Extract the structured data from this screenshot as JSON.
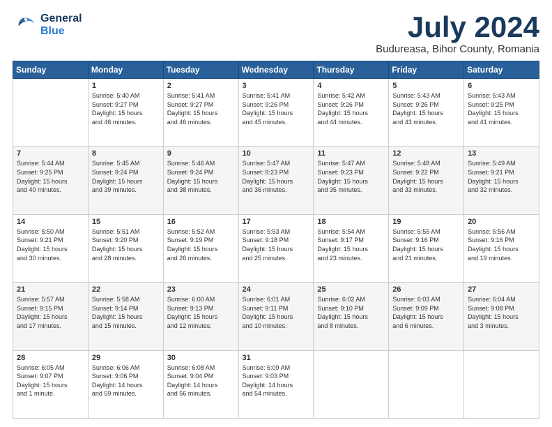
{
  "header": {
    "logo": {
      "general": "General",
      "blue": "Blue"
    },
    "title": "July 2024",
    "location": "Budureasa, Bihor County, Romania"
  },
  "weekdays": [
    "Sunday",
    "Monday",
    "Tuesday",
    "Wednesday",
    "Thursday",
    "Friday",
    "Saturday"
  ],
  "weeks": [
    [
      {
        "day": "",
        "info": ""
      },
      {
        "day": "1",
        "info": "Sunrise: 5:40 AM\nSunset: 9:27 PM\nDaylight: 15 hours\nand 46 minutes."
      },
      {
        "day": "2",
        "info": "Sunrise: 5:41 AM\nSunset: 9:27 PM\nDaylight: 15 hours\nand 46 minutes."
      },
      {
        "day": "3",
        "info": "Sunrise: 5:41 AM\nSunset: 9:26 PM\nDaylight: 15 hours\nand 45 minutes."
      },
      {
        "day": "4",
        "info": "Sunrise: 5:42 AM\nSunset: 9:26 PM\nDaylight: 15 hours\nand 44 minutes."
      },
      {
        "day": "5",
        "info": "Sunrise: 5:43 AM\nSunset: 9:26 PM\nDaylight: 15 hours\nand 43 minutes."
      },
      {
        "day": "6",
        "info": "Sunrise: 5:43 AM\nSunset: 9:25 PM\nDaylight: 15 hours\nand 41 minutes."
      }
    ],
    [
      {
        "day": "7",
        "info": "Sunrise: 5:44 AM\nSunset: 9:25 PM\nDaylight: 15 hours\nand 40 minutes."
      },
      {
        "day": "8",
        "info": "Sunrise: 5:45 AM\nSunset: 9:24 PM\nDaylight: 15 hours\nand 39 minutes."
      },
      {
        "day": "9",
        "info": "Sunrise: 5:46 AM\nSunset: 9:24 PM\nDaylight: 15 hours\nand 38 minutes."
      },
      {
        "day": "10",
        "info": "Sunrise: 5:47 AM\nSunset: 9:23 PM\nDaylight: 15 hours\nand 36 minutes."
      },
      {
        "day": "11",
        "info": "Sunrise: 5:47 AM\nSunset: 9:23 PM\nDaylight: 15 hours\nand 35 minutes."
      },
      {
        "day": "12",
        "info": "Sunrise: 5:48 AM\nSunset: 9:22 PM\nDaylight: 15 hours\nand 33 minutes."
      },
      {
        "day": "13",
        "info": "Sunrise: 5:49 AM\nSunset: 9:21 PM\nDaylight: 15 hours\nand 32 minutes."
      }
    ],
    [
      {
        "day": "14",
        "info": "Sunrise: 5:50 AM\nSunset: 9:21 PM\nDaylight: 15 hours\nand 30 minutes."
      },
      {
        "day": "15",
        "info": "Sunrise: 5:51 AM\nSunset: 9:20 PM\nDaylight: 15 hours\nand 28 minutes."
      },
      {
        "day": "16",
        "info": "Sunrise: 5:52 AM\nSunset: 9:19 PM\nDaylight: 15 hours\nand 26 minutes."
      },
      {
        "day": "17",
        "info": "Sunrise: 5:53 AM\nSunset: 9:18 PM\nDaylight: 15 hours\nand 25 minutes."
      },
      {
        "day": "18",
        "info": "Sunrise: 5:54 AM\nSunset: 9:17 PM\nDaylight: 15 hours\nand 23 minutes."
      },
      {
        "day": "19",
        "info": "Sunrise: 5:55 AM\nSunset: 9:16 PM\nDaylight: 15 hours\nand 21 minutes."
      },
      {
        "day": "20",
        "info": "Sunrise: 5:56 AM\nSunset: 9:16 PM\nDaylight: 15 hours\nand 19 minutes."
      }
    ],
    [
      {
        "day": "21",
        "info": "Sunrise: 5:57 AM\nSunset: 9:15 PM\nDaylight: 15 hours\nand 17 minutes."
      },
      {
        "day": "22",
        "info": "Sunrise: 5:58 AM\nSunset: 9:14 PM\nDaylight: 15 hours\nand 15 minutes."
      },
      {
        "day": "23",
        "info": "Sunrise: 6:00 AM\nSunset: 9:13 PM\nDaylight: 15 hours\nand 12 minutes."
      },
      {
        "day": "24",
        "info": "Sunrise: 6:01 AM\nSunset: 9:11 PM\nDaylight: 15 hours\nand 10 minutes."
      },
      {
        "day": "25",
        "info": "Sunrise: 6:02 AM\nSunset: 9:10 PM\nDaylight: 15 hours\nand 8 minutes."
      },
      {
        "day": "26",
        "info": "Sunrise: 6:03 AM\nSunset: 9:09 PM\nDaylight: 15 hours\nand 6 minutes."
      },
      {
        "day": "27",
        "info": "Sunrise: 6:04 AM\nSunset: 9:08 PM\nDaylight: 15 hours\nand 3 minutes."
      }
    ],
    [
      {
        "day": "28",
        "info": "Sunrise: 6:05 AM\nSunset: 9:07 PM\nDaylight: 15 hours\nand 1 minute."
      },
      {
        "day": "29",
        "info": "Sunrise: 6:06 AM\nSunset: 9:06 PM\nDaylight: 14 hours\nand 59 minutes."
      },
      {
        "day": "30",
        "info": "Sunrise: 6:08 AM\nSunset: 9:04 PM\nDaylight: 14 hours\nand 56 minutes."
      },
      {
        "day": "31",
        "info": "Sunrise: 6:09 AM\nSunset: 9:03 PM\nDaylight: 14 hours\nand 54 minutes."
      },
      {
        "day": "",
        "info": ""
      },
      {
        "day": "",
        "info": ""
      },
      {
        "day": "",
        "info": ""
      }
    ]
  ]
}
